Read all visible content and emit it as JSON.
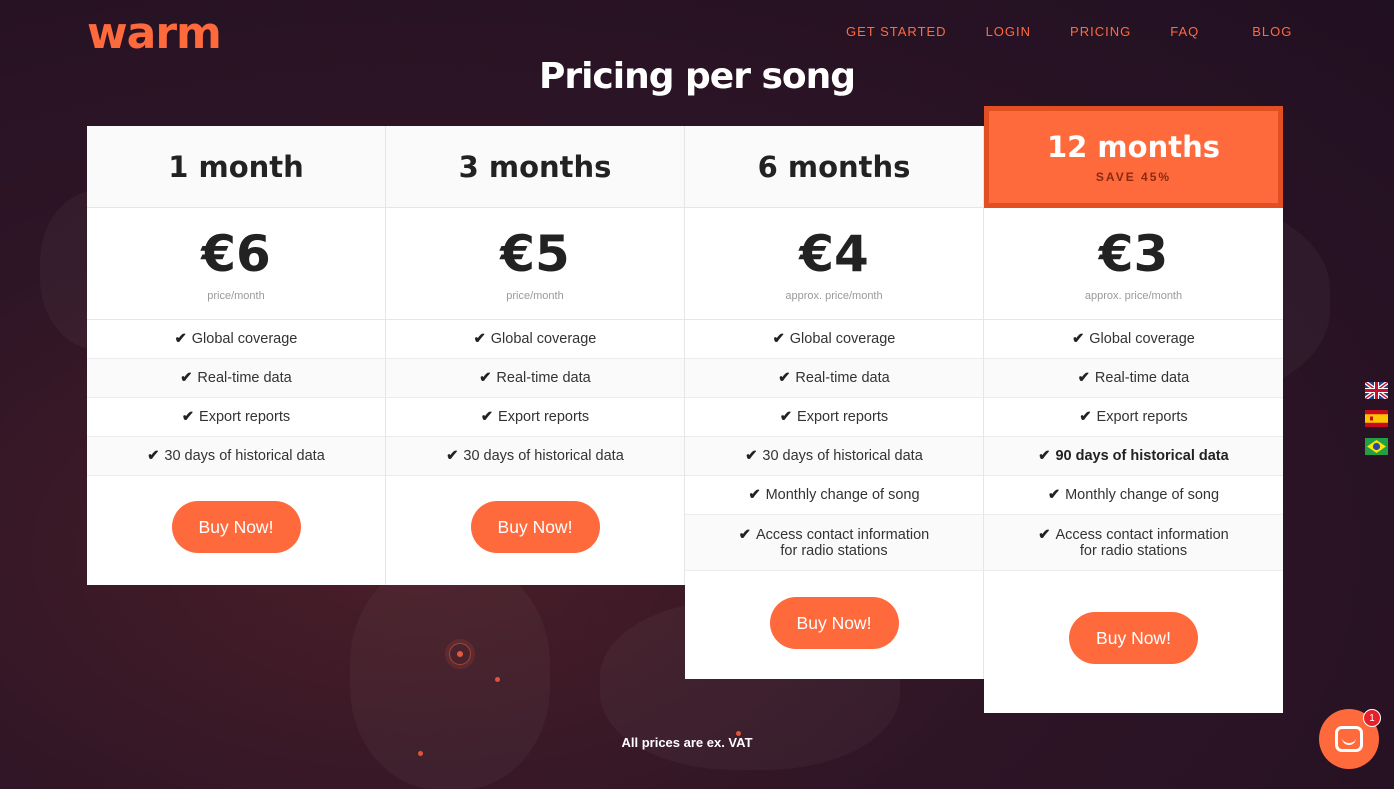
{
  "brand": {
    "logo_text": "warm",
    "accent": "#ff6a3d",
    "featured_border": "#e24f22"
  },
  "nav": {
    "items": [
      "GET STARTED",
      "LOGIN",
      "PRICING",
      "FAQ",
      "BLOG"
    ]
  },
  "page": {
    "title": "Pricing per song",
    "vat_note": "All prices are ex. VAT"
  },
  "plans": [
    {
      "name": "1 month",
      "price": "€6",
      "price_sub": "price/month",
      "features": [
        "Global coverage",
        "Real-time data",
        "Export reports",
        "30 days of historical data"
      ],
      "cta": "Buy Now!"
    },
    {
      "name": "3 months",
      "price": "€5",
      "price_sub": "price/month",
      "features": [
        "Global coverage",
        "Real-time data",
        "Export reports",
        "30 days of historical data"
      ],
      "cta": "Buy Now!"
    },
    {
      "name": "6 months",
      "price": "€4",
      "price_sub": "approx. price/month",
      "features": [
        "Global coverage",
        "Real-time data",
        "Export reports",
        "30 days of historical data",
        "Monthly change of song",
        "Access contact information",
        "for radio stations"
      ],
      "cta": "Buy Now!"
    },
    {
      "name": "12 months",
      "badge": "SAVE 45%",
      "price": "€3",
      "price_sub": "approx. price/month",
      "features": [
        "Global coverage",
        "Real-time data",
        "Export reports",
        "90 days of historical data",
        "Monthly change of song",
        "Access contact information",
        "for radio stations"
      ],
      "cta": "Buy Now!"
    }
  ],
  "language_flags": [
    "uk-flag-icon",
    "spain-flag-icon",
    "brazil-flag-icon"
  ],
  "chat": {
    "badge_count": "1"
  }
}
